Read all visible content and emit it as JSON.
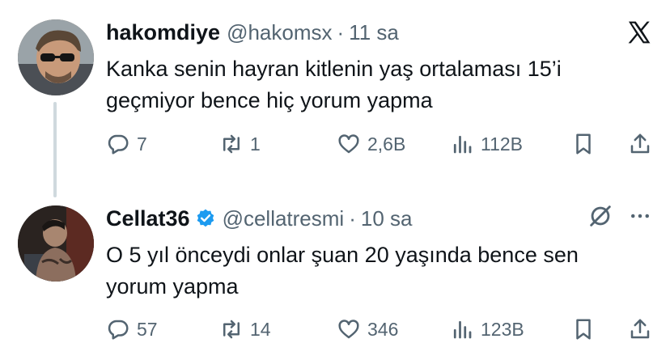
{
  "tweets": [
    {
      "display_name": "hakomdiye",
      "handle": "@hakomsx",
      "separator": "·",
      "time": "11 sa",
      "verified": false,
      "text": "Kanka senin hayran kitlenin yaş ortalaması 15’i geçmiyor bence hiç yorum yapma",
      "replies": "7",
      "retweets": "1",
      "likes": "2,6B",
      "views": "112B"
    },
    {
      "display_name": "Cellat36",
      "handle": "@cellatresmi",
      "separator": "·",
      "time": "10 sa",
      "verified": true,
      "text": "O 5 yıl önceydi onlar şuan 20 yaşında bence sen yorum yapma",
      "replies": "57",
      "retweets": "14",
      "likes": "346",
      "views": "123B"
    }
  ],
  "icons": {
    "brand": "x-logo-icon",
    "reply": "reply-icon",
    "retweet": "retweet-icon",
    "like": "heart-icon",
    "views": "views-icon",
    "bookmark": "bookmark-icon",
    "share": "share-icon",
    "grok": "grok-icon",
    "more": "more-icon"
  },
  "colors": {
    "text": "#0f1419",
    "secondary": "#536471",
    "verified": "#1d9bf0",
    "thread_line": "#cfd9de"
  }
}
